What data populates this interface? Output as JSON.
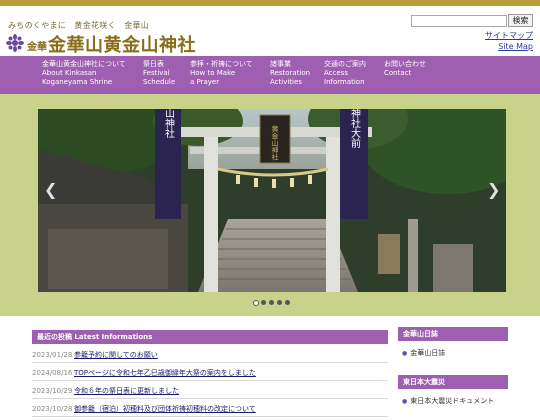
{
  "header": {
    "tagline": "みちのくやまに　黄金花咲く　金華山",
    "logo_small": "金華",
    "logo_title": "金華山黄金山神社",
    "search_placeholder": "",
    "search_button": "検索",
    "sitemap_ja": "サイトマップ",
    "sitemap_en": "Site Map"
  },
  "nav": [
    {
      "ja": "金華山黄金山神社について",
      "en1": "About Kinkasan",
      "en2": "Koganeyama Shrine"
    },
    {
      "ja": "祭日表",
      "en1": "Festival",
      "en2": "Schedule"
    },
    {
      "ja": "参拝・祈祷について",
      "en1": "How to Make",
      "en2": "a Prayer"
    },
    {
      "ja": "諸事業",
      "en1": "Restoration",
      "en2": "Activities"
    },
    {
      "ja": "交通のご案内",
      "en1": "Access",
      "en2": "Information"
    },
    {
      "ja": "お問い合わせ",
      "en1": "Contact",
      "en2": ""
    }
  ],
  "slider": {
    "prev_icon": "chevron-left-icon",
    "next_icon": "chevron-right-icon",
    "active_index": 0,
    "dot_count": 5,
    "banner_right": "山神社大前",
    "banner_left": "山神社",
    "plaque": "黄金山神社"
  },
  "news": {
    "heading": "最近の投稿 Latest Informations",
    "items": [
      {
        "date": "2023/01/28",
        "title": "参籠予約に関してのお願い"
      },
      {
        "date": "2024/08/16",
        "title": "TOPページに令和七年乙巳歳御縁年大祭の案内をしました"
      },
      {
        "date": "2023/10/29",
        "title": "令和６年の祭日表に更新しました"
      },
      {
        "date": "2023/10/28",
        "title": "御参籠（宿泊）初穂料及び団体祈祷初穂料の改定について"
      }
    ]
  },
  "sidebar": {
    "diary_heading": "金華山日誌",
    "diary_link": "金華山日誌",
    "quake_heading": "東日本大震災",
    "quake_link": "東日本大震災ドキュメント"
  },
  "colors": {
    "accent_purple": "#9f5fb1",
    "gold": "#b79d3b",
    "green_band": "#c9d28a",
    "link_blue": "#2c3a9a"
  }
}
